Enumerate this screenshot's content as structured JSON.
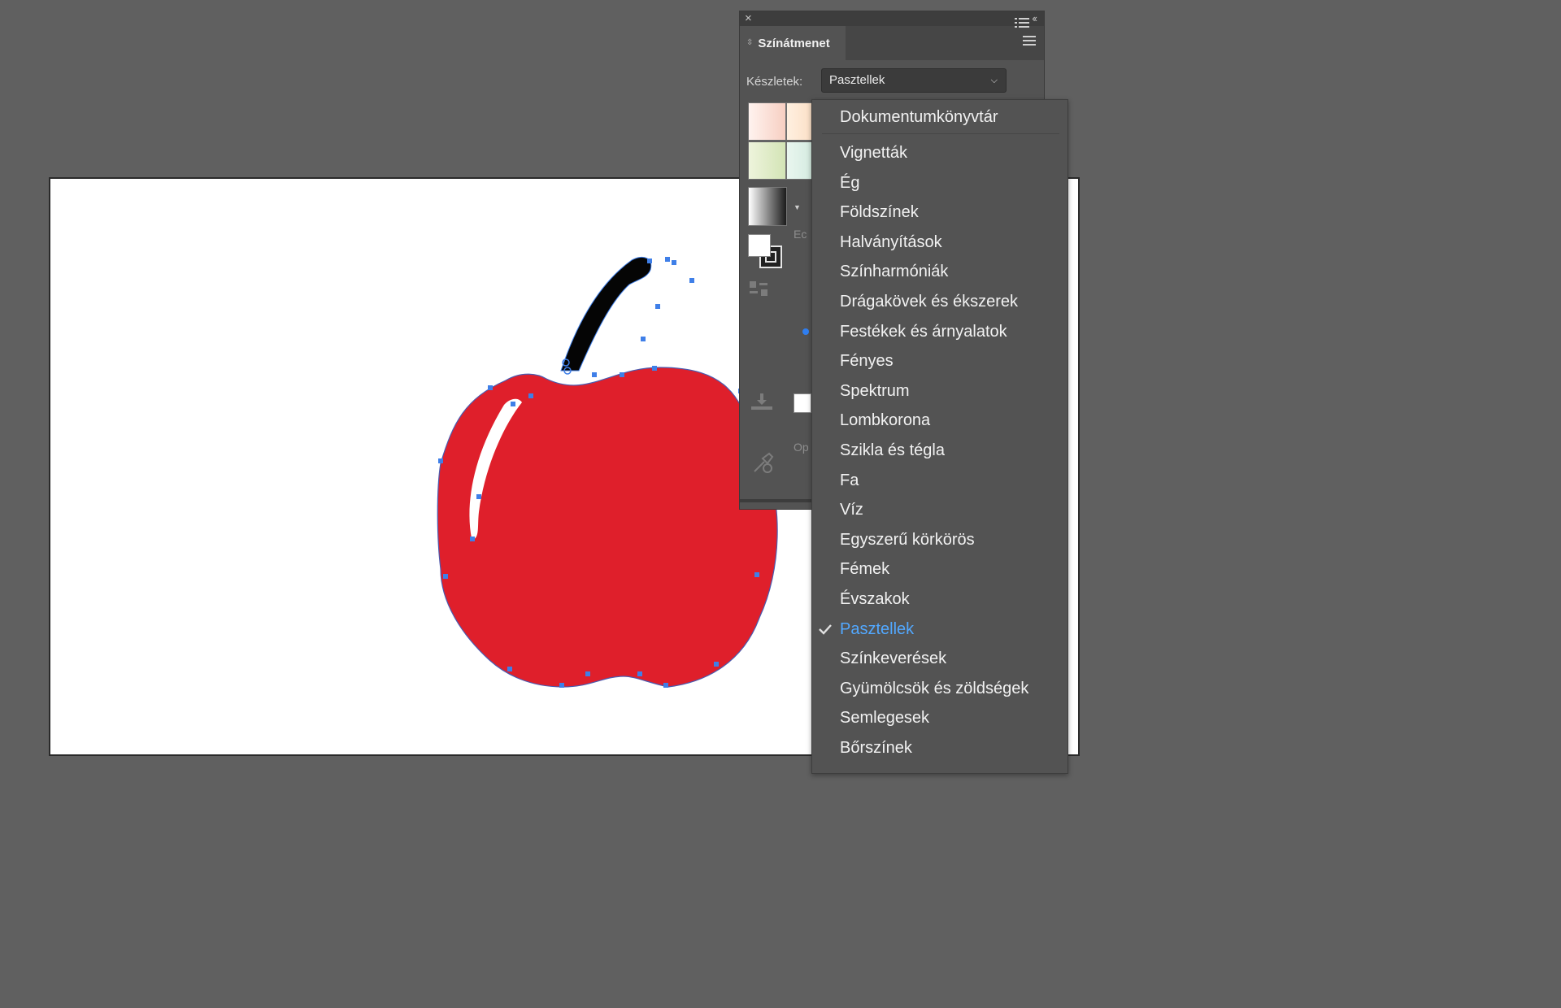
{
  "panel": {
    "title": "Színátmenet",
    "presets_label": "Készletek:",
    "presets_value": "Pasztellek",
    "faded_text_1": "Ec",
    "faded_text_2": "Op",
    "swatch_colors": [
      "#f8d9cf",
      "#fbe0c9",
      "#dce8c2",
      "#d4ebe1"
    ]
  },
  "menu": {
    "top_item": "Dokumentumkönyvtár",
    "items": [
      "Vignetták",
      "Ég",
      "Földszínek",
      "Halványítások",
      "Színharmóniák",
      "Drágakövek és ékszerek",
      "Festékek és árnyalatok",
      "Fényes",
      "Spektrum",
      "Lombkorona",
      "Szikla és tégla",
      "Fa",
      "Víz",
      "Egyszerű körkörös",
      "Fémek",
      "Évszakok",
      "Pasztellek",
      "Színkeverések",
      "Gyümölcsök és zöldségek",
      "Semlegesek",
      "Bőrszínek"
    ],
    "selected": "Pasztellek",
    "bulleted": "Festékek és árnyalatok"
  },
  "colors": {
    "canvas_bg": "#606060",
    "apple_red": "#df1f2b",
    "selection_blue": "#3f7fe8",
    "menu_highlight": "#52a8ff",
    "bullet_blue": "#2f7ef0"
  },
  "icons": [
    "close-icon",
    "collapse-panel-icon",
    "hamburger-menu-icon",
    "list-view-icon",
    "dropdown-chevron-icon",
    "checkmark-icon",
    "eyedropper-icon",
    "save-gradient-icon",
    "swap-fill-stroke-icon"
  ]
}
